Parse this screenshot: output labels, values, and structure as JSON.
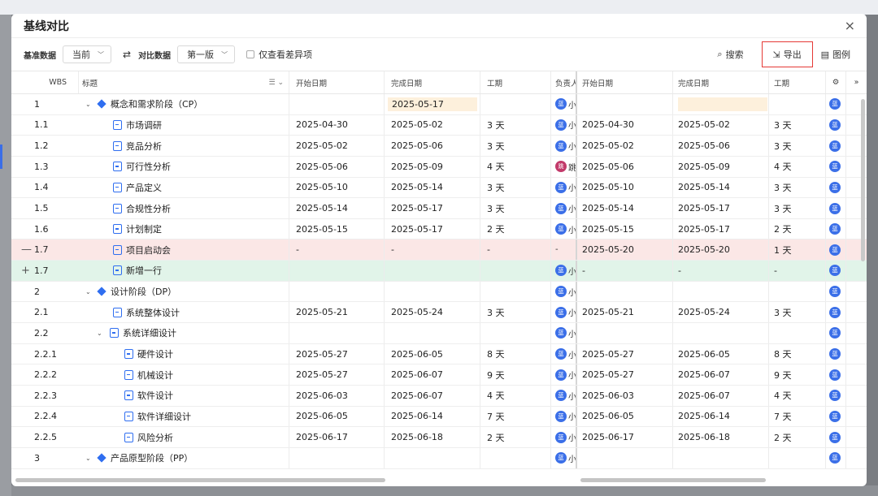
{
  "modal": {
    "title": "基线对比",
    "close": "×"
  },
  "toolbar": {
    "baseline_label": "基准数据",
    "baseline_value": "当前",
    "compare_label": "对比数据",
    "compare_value": "第一版",
    "diff_only_label": "仅查看差异项",
    "search_label": "搜索",
    "export_label": "导出",
    "legend_label": "图例"
  },
  "columns": {
    "wbs": "WBS",
    "title": "标题",
    "start": "开始日期",
    "end": "完成日期",
    "duration": "工期",
    "owner": "负责人",
    "start2": "开始日期",
    "end2": "完成日期",
    "duration2": "工期"
  },
  "colors": {
    "accent": "#2f6ef0",
    "deleted_row": "#fbe7e6",
    "added_row": "#e1f4e9",
    "highlight": "#fdf0dc",
    "export_border": "#e53935"
  },
  "rows": [
    {
      "sign": "",
      "wbs": "1",
      "level": 0,
      "caret": "⌄",
      "icon": "milestone-icon",
      "title": "概念和需求阶段（CP）",
      "start": "",
      "end": "2025-05-17",
      "end_hl": true,
      "dur": "",
      "owner": "小",
      "owner_avatar": "蓝",
      "start2": "",
      "end2": "",
      "end2_hl": true,
      "dur2": "",
      "row_type": "normal"
    },
    {
      "sign": "",
      "wbs": "1.1",
      "level": 1,
      "caret": "",
      "icon": "task-icon",
      "title": "市场调研",
      "start": "2025-04-30",
      "end": "2025-05-02",
      "dur": "3 天",
      "owner": "小",
      "owner_avatar": "蓝",
      "start2": "2025-04-30",
      "end2": "2025-05-02",
      "dur2": "3 天",
      "row_type": "normal"
    },
    {
      "sign": "",
      "wbs": "1.2",
      "level": 1,
      "caret": "",
      "icon": "task-icon",
      "title": "竞品分析",
      "start": "2025-05-02",
      "end": "2025-05-06",
      "dur": "3 天",
      "owner": "小",
      "owner_avatar": "蓝",
      "start2": "2025-05-02",
      "end2": "2025-05-06",
      "dur2": "3 天",
      "row_type": "normal"
    },
    {
      "sign": "",
      "wbs": "1.3",
      "level": 1,
      "caret": "",
      "icon": "task-icon",
      "title": "可行性分析",
      "start": "2025-05-06",
      "end": "2025-05-09",
      "dur": "4 天",
      "owner": "跳",
      "owner_avatar": "跳",
      "owner_red": true,
      "start2": "2025-05-06",
      "end2": "2025-05-09",
      "dur2": "4 天",
      "row_type": "normal"
    },
    {
      "sign": "",
      "wbs": "1.4",
      "level": 1,
      "caret": "",
      "icon": "task-icon",
      "title": "产品定义",
      "start": "2025-05-10",
      "end": "2025-05-14",
      "dur": "3 天",
      "owner": "小",
      "owner_avatar": "蓝",
      "start2": "2025-05-10",
      "end2": "2025-05-14",
      "dur2": "3 天",
      "row_type": "normal"
    },
    {
      "sign": "",
      "wbs": "1.5",
      "level": 1,
      "caret": "",
      "icon": "task-icon",
      "title": "合规性分析",
      "start": "2025-05-14",
      "end": "2025-05-17",
      "dur": "3 天",
      "owner": "小",
      "owner_avatar": "蓝",
      "start2": "2025-05-14",
      "end2": "2025-05-17",
      "dur2": "3 天",
      "row_type": "normal"
    },
    {
      "sign": "",
      "wbs": "1.6",
      "level": 1,
      "caret": "",
      "icon": "task-icon",
      "title": "计划制定",
      "start": "2025-05-15",
      "end": "2025-05-17",
      "dur": "2 天",
      "owner": "小",
      "owner_avatar": "蓝",
      "start2": "2025-05-15",
      "end2": "2025-05-17",
      "dur2": "2 天",
      "row_type": "normal"
    },
    {
      "sign": "—",
      "wbs": "1.7",
      "level": 1,
      "caret": "",
      "icon": "task-icon",
      "title": "项目启动会",
      "start": "-",
      "end": "-",
      "dur": "-",
      "owner": "-",
      "owner_avatar": "",
      "start2": "2025-05-20",
      "end2": "2025-05-20",
      "dur2": "1 天",
      "row_type": "del"
    },
    {
      "sign": "+",
      "wbs": "1.7",
      "level": 1,
      "caret": "",
      "icon": "task-icon",
      "title": "新增一行",
      "start": "",
      "end": "",
      "dur": "",
      "owner": "小",
      "owner_avatar": "蓝",
      "start2": "-",
      "end2": "-",
      "dur2": "-",
      "row_type": "add"
    },
    {
      "sign": "",
      "wbs": "2",
      "level": 0,
      "caret": "⌄",
      "icon": "milestone-icon",
      "title": "设计阶段（DP）",
      "start": "",
      "end": "",
      "dur": "",
      "owner": "小",
      "owner_avatar": "蓝",
      "start2": "",
      "end2": "",
      "dur2": "",
      "row_type": "normal"
    },
    {
      "sign": "",
      "wbs": "2.1",
      "level": 1,
      "caret": "",
      "icon": "task-icon",
      "title": "系统整体设计",
      "start": "2025-05-21",
      "end": "2025-05-24",
      "dur": "3 天",
      "owner": "小",
      "owner_avatar": "蓝",
      "start2": "2025-05-21",
      "end2": "2025-05-24",
      "dur2": "3 天",
      "row_type": "normal"
    },
    {
      "sign": "",
      "wbs": "2.2",
      "level": 1,
      "caret": "⌄",
      "icon": "task-icon",
      "title": "系统详细设计",
      "start": "",
      "end": "",
      "dur": "",
      "owner": "小",
      "owner_avatar": "蓝",
      "start2": "",
      "end2": "",
      "dur2": "",
      "row_type": "normal"
    },
    {
      "sign": "",
      "wbs": "2.2.1",
      "level": 2,
      "caret": "",
      "icon": "task-icon",
      "title": "硬件设计",
      "start": "2025-05-27",
      "end": "2025-06-05",
      "dur": "8 天",
      "owner": "小",
      "owner_avatar": "蓝",
      "start2": "2025-05-27",
      "end2": "2025-06-05",
      "dur2": "8 天",
      "row_type": "normal"
    },
    {
      "sign": "",
      "wbs": "2.2.2",
      "level": 2,
      "caret": "",
      "icon": "task-icon",
      "title": "机械设计",
      "start": "2025-05-27",
      "end": "2025-06-07",
      "dur": "9 天",
      "owner": "小",
      "owner_avatar": "蓝",
      "start2": "2025-05-27",
      "end2": "2025-06-07",
      "dur2": "9 天",
      "row_type": "normal"
    },
    {
      "sign": "",
      "wbs": "2.2.3",
      "level": 2,
      "caret": "",
      "icon": "task-icon",
      "title": "软件设计",
      "start": "2025-06-03",
      "end": "2025-06-07",
      "dur": "4 天",
      "owner": "小",
      "owner_avatar": "蓝",
      "start2": "2025-06-03",
      "end2": "2025-06-07",
      "dur2": "4 天",
      "row_type": "normal"
    },
    {
      "sign": "",
      "wbs": "2.2.4",
      "level": 2,
      "caret": "",
      "icon": "task-icon",
      "title": "软件详细设计",
      "start": "2025-06-05",
      "end": "2025-06-14",
      "dur": "7 天",
      "owner": "小",
      "owner_avatar": "蓝",
      "start2": "2025-06-05",
      "end2": "2025-06-14",
      "dur2": "7 天",
      "row_type": "normal"
    },
    {
      "sign": "",
      "wbs": "2.2.5",
      "level": 2,
      "caret": "",
      "icon": "task-icon",
      "title": "风险分析",
      "start": "2025-06-17",
      "end": "2025-06-18",
      "dur": "2 天",
      "owner": "小",
      "owner_avatar": "蓝",
      "start2": "2025-06-17",
      "end2": "2025-06-18",
      "dur2": "2 天",
      "row_type": "normal"
    },
    {
      "sign": "",
      "wbs": "3",
      "level": 0,
      "caret": "⌄",
      "icon": "milestone-icon",
      "title": "产品原型阶段（PP）",
      "start": "",
      "end": "",
      "dur": "",
      "owner": "小",
      "owner_avatar": "蓝",
      "start2": "",
      "end2": "",
      "dur2": "",
      "row_type": "normal"
    }
  ]
}
